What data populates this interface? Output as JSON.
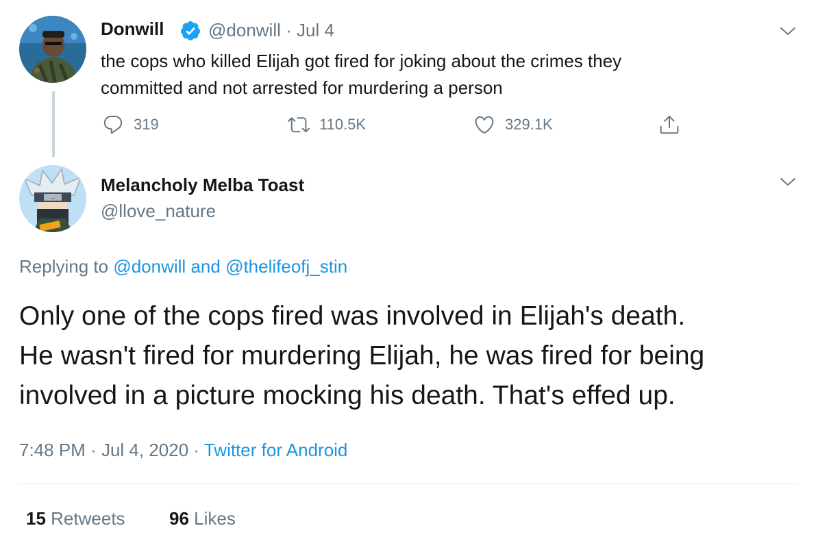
{
  "parent_tweet": {
    "display_name": "Donwill",
    "verified": true,
    "handle": "@donwill",
    "separator": "·",
    "date": "Jul 4",
    "text_line1": "the cops who killed Elijah got fired for joking about the crimes they",
    "text_line2": "committed and not arrested for murdering a person",
    "replies": "319",
    "retweets": "110.5K",
    "likes": "329.1K"
  },
  "reply_tweet": {
    "display_name": "Melancholy Melba Toast",
    "handle": "@llove_nature",
    "replying_prefix": "Replying to",
    "replying_user1": "@donwill",
    "replying_and": "and",
    "replying_user2": "@thelifeofj_stin",
    "text_line1": "Only one of the cops fired was involved in Elijah's death.",
    "text_line2": "He wasn't fired for murdering Elijah, he was fired for being",
    "text_line3": "involved in a picture mocking his death. That's effed up.",
    "time": "7:48 PM",
    "dot1": "·",
    "date": "Jul 4, 2020",
    "dot2": "·",
    "source": "Twitter for Android",
    "retweet_count": "15",
    "retweet_label": "Retweets",
    "like_count": "96",
    "like_label": "Likes"
  },
  "colors": {
    "text": "#14171a",
    "muted": "#657786",
    "link": "#1b95e0",
    "verified": "#1da1f2",
    "divider": "#e6ecf0"
  },
  "icons": [
    "verified-badge-icon",
    "chevron-down-icon",
    "reply-icon",
    "retweet-icon",
    "like-icon",
    "share-icon"
  ]
}
